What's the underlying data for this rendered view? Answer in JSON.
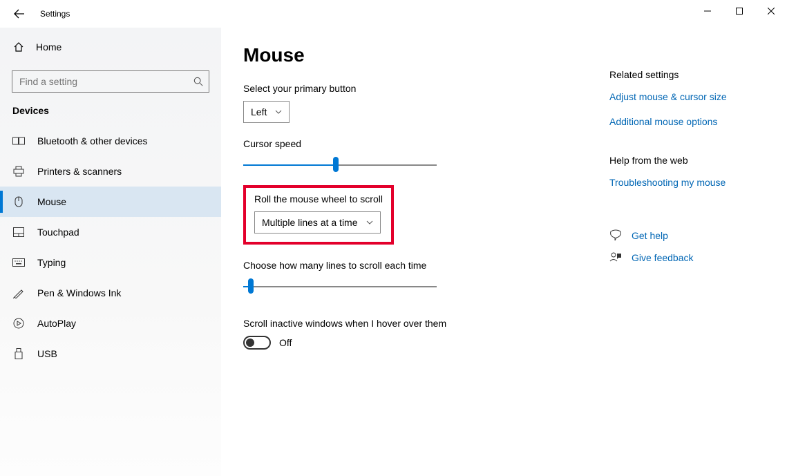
{
  "window": {
    "title": "Settings"
  },
  "sidebar": {
    "home_label": "Home",
    "search_placeholder": "Find a setting",
    "category": "Devices",
    "items": [
      {
        "label": "Bluetooth & other devices"
      },
      {
        "label": "Printers & scanners"
      },
      {
        "label": "Mouse"
      },
      {
        "label": "Touchpad"
      },
      {
        "label": "Typing"
      },
      {
        "label": "Pen & Windows Ink"
      },
      {
        "label": "AutoPlay"
      },
      {
        "label": "USB"
      }
    ]
  },
  "main": {
    "title": "Mouse",
    "primary_label": "Select your primary button",
    "primary_value": "Left",
    "cursor_speed_label": "Cursor speed",
    "cursor_speed_percent": 48,
    "scroll_label": "Roll the mouse wheel to scroll",
    "scroll_value": "Multiple lines at a time",
    "lines_label": "Choose how many lines to scroll each time",
    "lines_percent": 4,
    "inactive_label": "Scroll inactive windows when I hover over them",
    "inactive_state": "Off"
  },
  "rightcol": {
    "related_head": "Related settings",
    "links": [
      "Adjust mouse & cursor size",
      "Additional mouse options"
    ],
    "help_head": "Help from the web",
    "help_link": "Troubleshooting my mouse",
    "get_help": "Get help",
    "give_feedback": "Give feedback"
  }
}
